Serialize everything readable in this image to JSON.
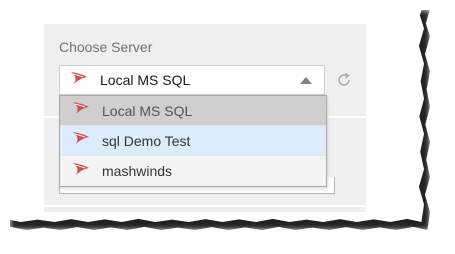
{
  "panel": {
    "label": "Choose Server"
  },
  "server_select": {
    "selected": "Local MS SQL",
    "icon": "sql-server-icon"
  },
  "dropdown": {
    "options": [
      {
        "label": "Local MS SQL",
        "state": "selected"
      },
      {
        "label": "sql Demo Test",
        "state": "hovered"
      },
      {
        "label": "mashwinds",
        "state": "normal"
      }
    ]
  },
  "icons": {
    "refresh": "refresh-icon",
    "caret": "chevron-up-icon"
  },
  "colors": {
    "sql_icon": "#d94a4a",
    "hover_bg": "#dcecfc",
    "selected_bg": "#cfcfcf",
    "panel_bg": "#efefef"
  }
}
